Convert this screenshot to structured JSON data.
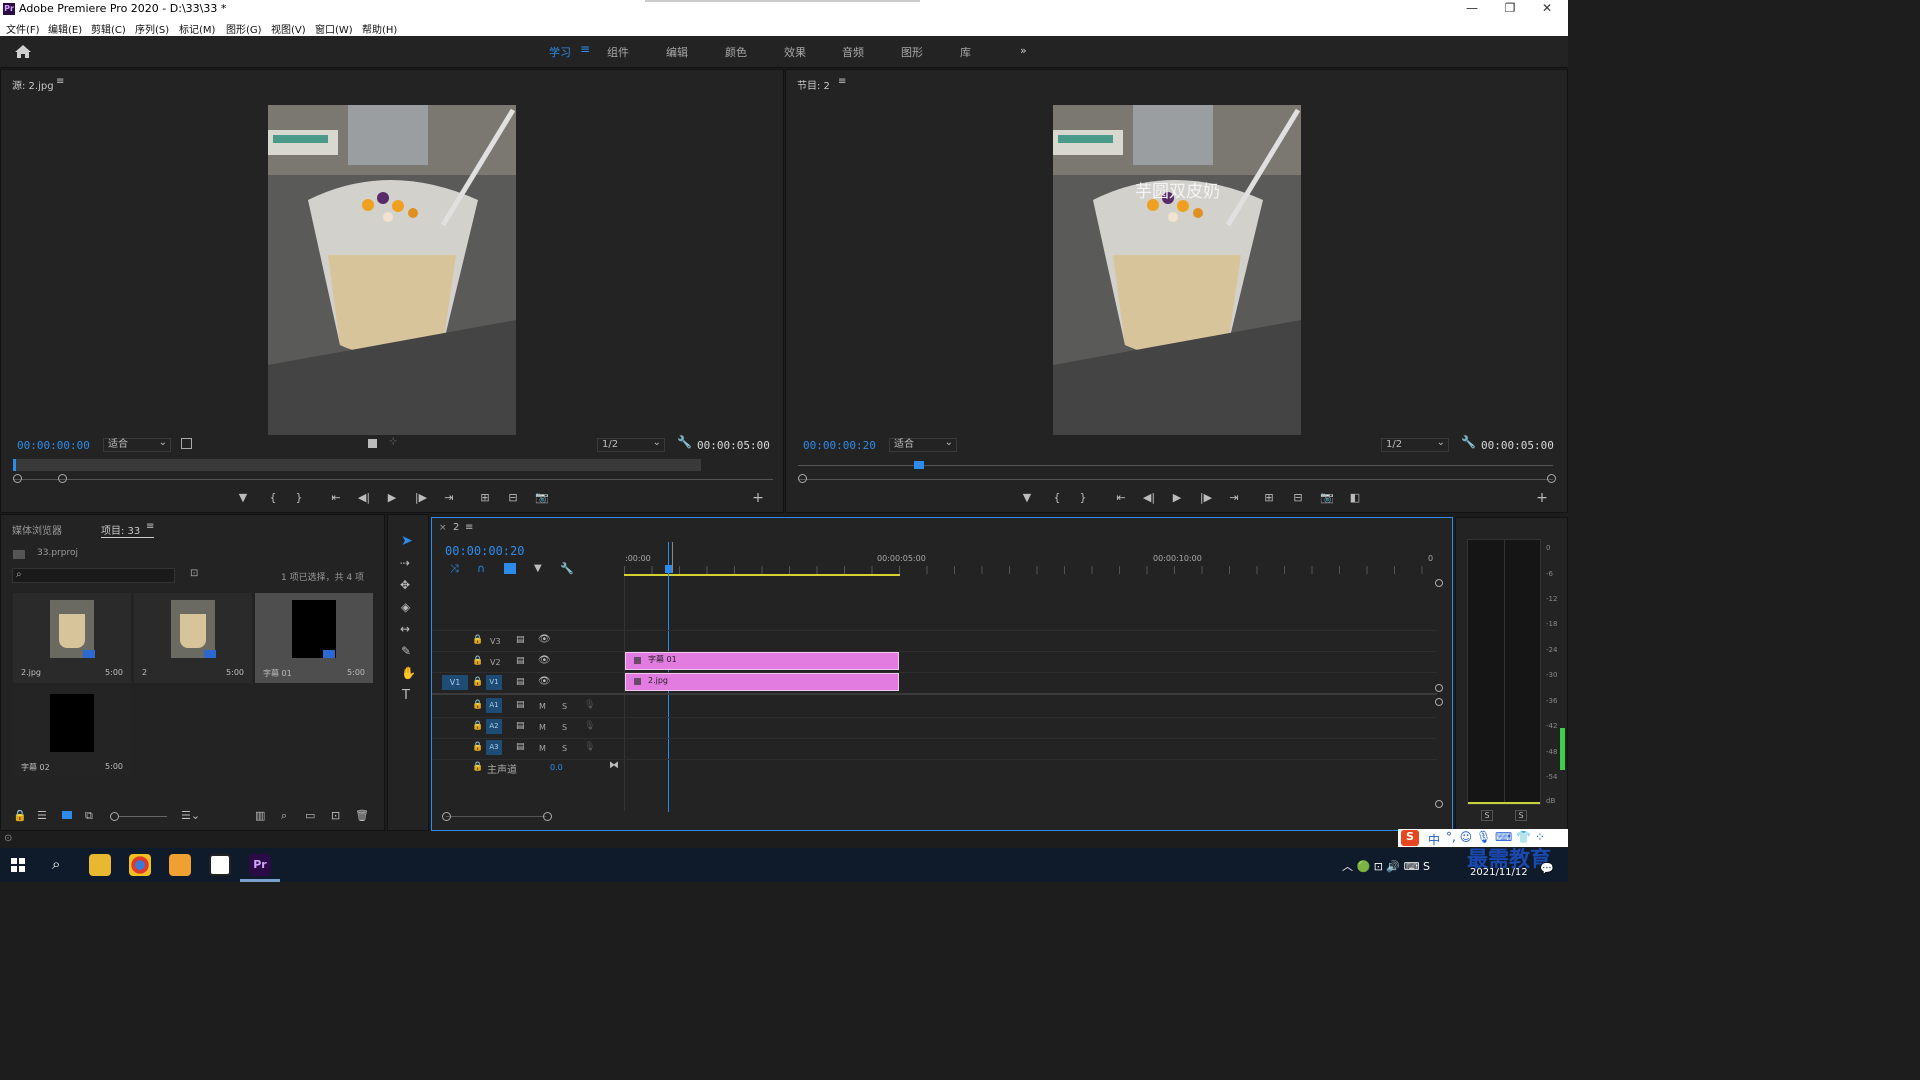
{
  "window": {
    "title": "Adobe Premiere Pro 2020 - D:\\33\\33 *",
    "logo": "Pr"
  },
  "menu": [
    "文件(F)",
    "编辑(E)",
    "剪辑(C)",
    "序列(S)",
    "标记(M)",
    "图形(G)",
    "视图(V)",
    "窗口(W)",
    "帮助(H)"
  ],
  "workspaces": [
    "学习",
    "组件",
    "编辑",
    "颜色",
    "效果",
    "音频",
    "图形",
    "库"
  ],
  "active_workspace": "学习",
  "source_monitor": {
    "title": "源: 2.jpg",
    "timecode": "00:00:00:00",
    "fit": "适合",
    "resolution": "1/2",
    "duration": "00:00:05:00"
  },
  "program_monitor": {
    "title": "节目: 2",
    "timecode": "00:00:00:20",
    "fit": "适合",
    "resolution": "1/2",
    "duration": "00:00:05:00",
    "caption": "芋圆双皮奶"
  },
  "project": {
    "tab_media": "媒体浏览器",
    "tab_project": "项目: 33",
    "file": "33.prproj",
    "selection": "1 项已选择，共 4 项",
    "items": [
      {
        "name": "2.jpg",
        "duration": "5:00"
      },
      {
        "name": "2",
        "duration": "5:00"
      },
      {
        "name": "字幕 01",
        "duration": "5:00"
      },
      {
        "name": "字幕 02",
        "duration": "5:00"
      }
    ]
  },
  "timeline": {
    "tab": "2",
    "timecode": "00:00:00:20",
    "ruler": [
      ":00:00",
      "00:00:05:00",
      "00:00:10:00",
      "0"
    ],
    "video_tracks": [
      "V3",
      "V2",
      "V1"
    ],
    "audio_tracks": [
      "A1",
      "A2",
      "A3"
    ],
    "source_patch": "V1",
    "master_label": "主声道",
    "master_value": "0.0",
    "clips": [
      {
        "track": "V2",
        "name": "字幕 01"
      },
      {
        "track": "V1",
        "name": "2.jpg"
      }
    ],
    "mute": "M",
    "solo": "S"
  },
  "audio_meter": {
    "scale": [
      "0",
      "-6",
      "-12",
      "-18",
      "-24",
      "-30",
      "-36",
      "-42",
      "-48",
      "-54",
      "dB"
    ],
    "solo_left": "S",
    "solo_right": "S"
  },
  "taskbar": {
    "watermark": "最需教育",
    "date": "2021/11/12",
    "ime": "中"
  }
}
